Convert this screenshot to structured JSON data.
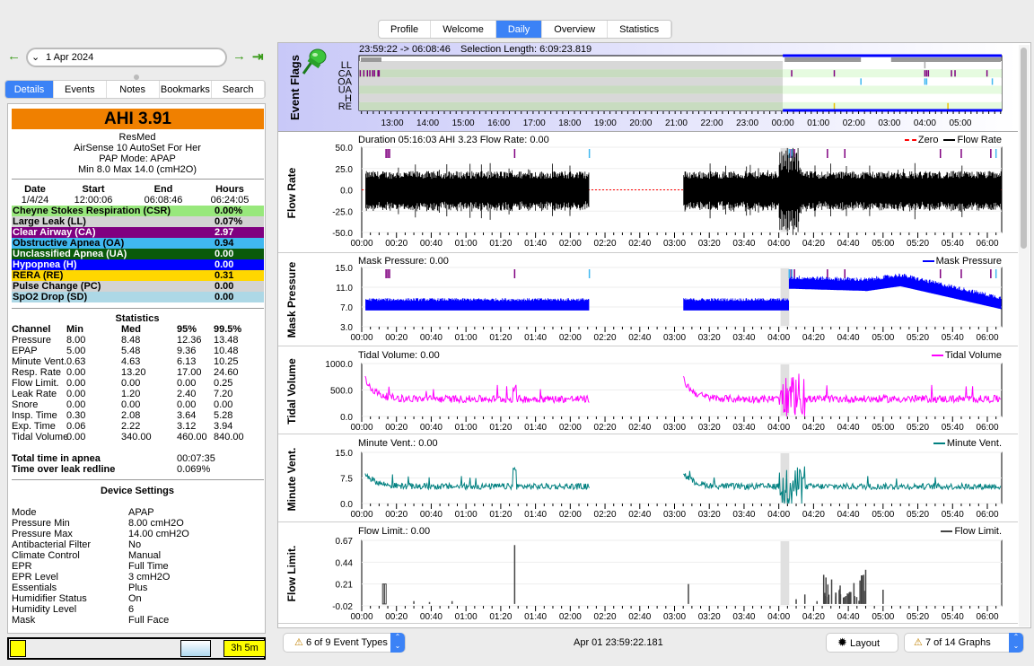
{
  "top_tabs": [
    {
      "label": "Profile"
    },
    {
      "label": "Welcome"
    },
    {
      "label": "Daily",
      "active": true
    },
    {
      "label": "Overview"
    },
    {
      "label": "Statistics"
    }
  ],
  "date_nav": {
    "date": "1 Apr 2024",
    "prev_icon": "arrow-left-icon",
    "next_icon": "arrow-right-icon",
    "last_icon": "arrow-to-end-icon"
  },
  "left_tabs": [
    {
      "label": "Details",
      "active": true
    },
    {
      "label": "Events"
    },
    {
      "label": "Notes"
    },
    {
      "label": "Bookmarks"
    },
    {
      "label": "Search"
    }
  ],
  "summary": {
    "ahi": "AHI  3.91",
    "ahi_color": "#f08000",
    "brand": "ResMed",
    "model": "AirSense 10 AutoSet For Her",
    "mode": "PAP Mode: APAP",
    "pressure": "Min 8.0 Max 14.0 (cmH2O)"
  },
  "session": {
    "headers": [
      "Date",
      "Start",
      "End",
      "Hours"
    ],
    "values": [
      "1/4/24",
      "12:00:06",
      "06:08:46",
      "06:24:05"
    ]
  },
  "events": [
    {
      "label": "Cheyne Stokes Respiration (CSR)",
      "value": "0.00%",
      "bg": "#98e87c",
      "fg": "#000"
    },
    {
      "label": "Large Leak (LL)",
      "value": "0.07%",
      "bg": "#d3d3d3",
      "fg": "#000"
    },
    {
      "label": "Clear Airway (CA)",
      "value": "2.97",
      "bg": "#800080",
      "fg": "#fff"
    },
    {
      "label": "Obstructive Apnea (OA)",
      "value": "0.94",
      "bg": "#40b8f0",
      "fg": "#000"
    },
    {
      "label": "Unclassified Apnea (UA)",
      "value": "0.00",
      "bg": "#0a5a0a",
      "fg": "#fff"
    },
    {
      "label": "Hypopnea (H)",
      "value": "0.00",
      "bg": "#0000ff",
      "fg": "#fff"
    },
    {
      "label": "RERA (RE)",
      "value": "0.31",
      "bg": "#ffd700",
      "fg": "#000"
    },
    {
      "label": "Pulse Change (PC)",
      "value": "0.00",
      "bg": "#d3d3d3",
      "fg": "#000"
    },
    {
      "label": "SpO2 Drop (SD)",
      "value": "0.00",
      "bg": "#add8e6",
      "fg": "#000"
    }
  ],
  "statistics": {
    "title": "Statistics",
    "headers": [
      "Channel",
      "Min",
      "Med",
      "95%",
      "99.5%"
    ],
    "rows": [
      [
        "Pressure",
        "8.00",
        "8.48",
        "12.36",
        "13.48"
      ],
      [
        "EPAP",
        "5.00",
        "5.48",
        "9.36",
        "10.48"
      ],
      [
        "Minute Vent.",
        "0.63",
        "4.63",
        "6.13",
        "10.25"
      ],
      [
        "Resp. Rate",
        "0.00",
        "13.20",
        "17.00",
        "24.60"
      ],
      [
        "Flow Limit.",
        "0.00",
        "0.00",
        "0.00",
        "0.25"
      ],
      [
        "Leak Rate",
        "0.00",
        "1.20",
        "2.40",
        "7.20"
      ],
      [
        "Snore",
        "0.00",
        "0.00",
        "0.00",
        "0.00"
      ],
      [
        "Insp. Time",
        "0.30",
        "2.08",
        "3.64",
        "5.28"
      ],
      [
        "Exp. Time",
        "0.06",
        "2.22",
        "3.12",
        "3.94"
      ],
      [
        "Tidal Volume",
        "0.00",
        "340.00",
        "460.00",
        "840.00"
      ]
    ],
    "totals": [
      [
        "Total time in apnea",
        "00:07:35"
      ],
      [
        "Time over leak redline",
        "0.069%"
      ]
    ]
  },
  "device_settings": {
    "title": "Device Settings",
    "rows": [
      [
        "Mode",
        "APAP"
      ],
      [
        "Pressure Min",
        "8.00 cmH2O"
      ],
      [
        "Pressure Max",
        "14.00 cmH2O"
      ],
      [
        "Antibacterial Filter",
        "No"
      ],
      [
        "Climate Control",
        "Manual"
      ],
      [
        "EPR",
        "Full Time"
      ],
      [
        "EPR Level",
        "3 cmH2O"
      ],
      [
        "Essentials",
        "Plus"
      ],
      [
        "Humidifier Status",
        "On"
      ],
      [
        "Humidity Level",
        "6"
      ],
      [
        "Mask",
        "Full Face"
      ]
    ]
  },
  "bottom_left": {
    "duration": "3h 5m"
  },
  "event_flags": {
    "title": "Event Flags",
    "range": "23:59:22 -> 06:08:46",
    "selection": "Selection Length: 6:09:23.819",
    "rows": [
      "LL",
      "CA",
      "OA",
      "UA",
      "H",
      "RE"
    ],
    "xticks": [
      "13:00",
      "14:00",
      "15:00",
      "16:00",
      "17:00",
      "18:00",
      "19:00",
      "20:00",
      "21:00",
      "22:00",
      "23:00",
      "00:00",
      "01:00",
      "02:00",
      "03:00",
      "04:00",
      "05:00"
    ],
    "markers": {
      "CA": [
        12.1,
        12.2,
        12.3,
        12.37,
        12.45,
        12.5,
        12.6,
        12.63,
        24.25,
        25.45,
        28.0,
        28.05,
        28.1,
        28.75,
        28.85,
        29.75
      ],
      "OA": [
        26.2,
        28.0,
        28.05,
        29.9
      ],
      "RE": [
        25.45,
        28.65
      ],
      "LL": [
        28.0
      ]
    }
  },
  "xticks": [
    "00:00",
    "00:20",
    "00:40",
    "01:00",
    "01:20",
    "01:40",
    "02:00",
    "02:20",
    "02:40",
    "03:00",
    "03:20",
    "03:40",
    "04:00",
    "04:20",
    "04:40",
    "05:00",
    "05:20",
    "05:40",
    "06:00"
  ],
  "graphs": [
    {
      "id": "flow",
      "title": "Flow Rate",
      "header": "Duration 05:16:03 AHI 3.23 Flow Rate: 0.00",
      "legend": [
        {
          "label": "Zero",
          "color": "#ff0000",
          "dash": true
        },
        {
          "label": "Flow Rate",
          "color": "#000000"
        }
      ],
      "yticks": [
        "50.0",
        "25.0",
        "0.0",
        "-25.0",
        "-50.0"
      ],
      "ymin": -50,
      "ymax": 50,
      "color": "#000000"
    },
    {
      "id": "pressure",
      "title": "Mask Pressure",
      "header": "Mask Pressure: 0.00",
      "legend": [
        {
          "label": "Mask Pressure",
          "color": "#0000ff"
        }
      ],
      "yticks": [
        "15.0",
        "11.0",
        "7.0",
        "3.0"
      ],
      "ymin": 3,
      "ymax": 15,
      "color": "#0000ff"
    },
    {
      "id": "tv",
      "title": "Tidal Volume",
      "header": "Tidal Volume: 0.00",
      "legend": [
        {
          "label": "Tidal Volume",
          "color": "#ff00ff"
        }
      ],
      "yticks": [
        "1000.0",
        "500.0",
        "0.0"
      ],
      "ymin": 0,
      "ymax": 1000,
      "color": "#ff00ff"
    },
    {
      "id": "mv",
      "title": "Minute Vent.",
      "header": "Minute Vent.: 0.00",
      "legend": [
        {
          "label": "Minute Vent.",
          "color": "#008080"
        }
      ],
      "yticks": [
        "15.0",
        "7.5",
        "0.0"
      ],
      "ymin": 0,
      "ymax": 15,
      "color": "#008080"
    },
    {
      "id": "fl",
      "title": "Flow Limit.",
      "header": "Flow Limit.: 0.00",
      "legend": [
        {
          "label": "Flow Limit.",
          "color": "#444444"
        }
      ],
      "yticks": [
        "0.67",
        "0.44",
        "0.21",
        "-0.02"
      ],
      "ymin": -0.02,
      "ymax": 0.67,
      "color": "#444444"
    }
  ],
  "graph_events": {
    "CA": [
      14,
      15,
      16,
      88,
      247,
      249,
      268,
      278,
      333,
      345,
      362
    ],
    "OA": [
      131,
      246,
      247.5,
      365
    ],
    "CA_color": "#800080",
    "OA_color": "#40b8f0"
  },
  "footer": {
    "event_types": "6 of 9 Event Types",
    "timestamp": "Apr 01 23:59:22.181",
    "layout": "Layout",
    "graphs": "7 of 14 Graphs"
  }
}
